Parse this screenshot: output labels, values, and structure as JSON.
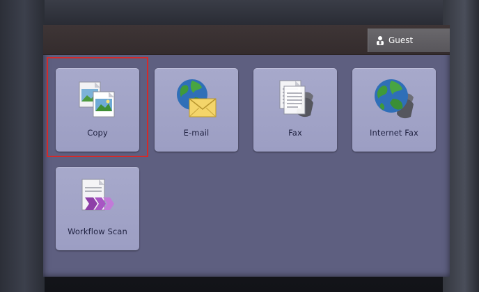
{
  "status_bar": {
    "user_label": "Guest",
    "user_icon": "user-icon"
  },
  "tiles": [
    {
      "label": "Copy",
      "icon": "copy-icon"
    },
    {
      "label": "E-mail",
      "icon": "email-icon"
    },
    {
      "label": "Fax",
      "icon": "fax-icon"
    },
    {
      "label": "Internet Fax",
      "icon": "internet-fax-icon"
    },
    {
      "label": "Workflow Scan",
      "icon": "workflow-scan-icon"
    }
  ],
  "colors": {
    "screen_background": "#5e5f80",
    "tile_background": "#a7a9cb",
    "status_bar": "#3e3536",
    "highlight": "#d42a2a"
  }
}
